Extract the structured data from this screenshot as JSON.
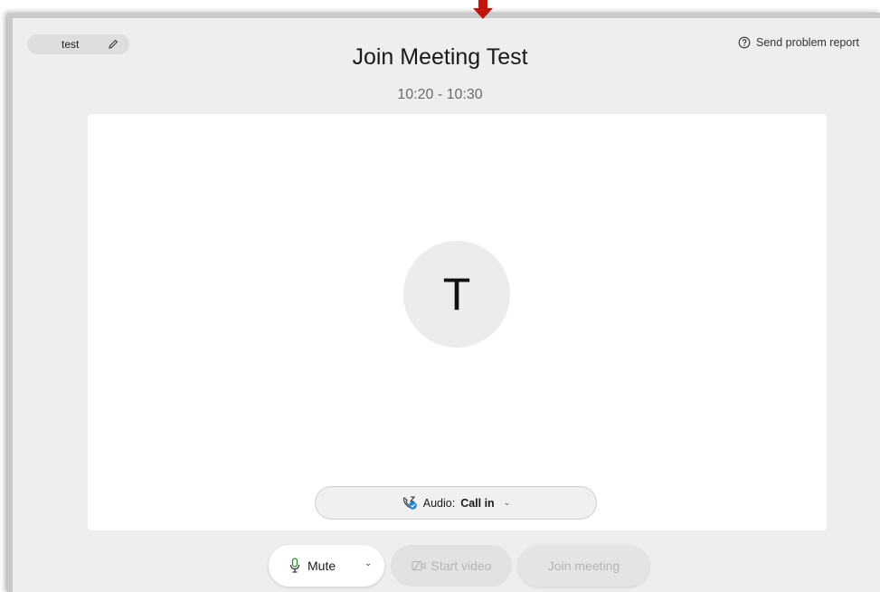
{
  "user": {
    "name": "test"
  },
  "header": {
    "report_link": "Send problem report"
  },
  "meeting": {
    "title": "Join Meeting Test",
    "time": "10:20 - 10:30"
  },
  "avatar": {
    "initial": "T"
  },
  "audio": {
    "label": "Audio:",
    "value": "Call in"
  },
  "controls": {
    "mute_label": "Mute",
    "video_label": "Start video",
    "join_label": "Join meeting"
  },
  "colors": {
    "arrow": "#c0140c",
    "mic": "#2e8b2e"
  }
}
